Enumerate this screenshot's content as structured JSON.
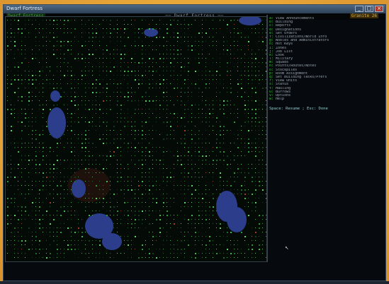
{
  "window": {
    "title": "Dwarf Fortress",
    "buttons": [
      "_",
      "□",
      "×"
    ]
  },
  "game_header": {
    "mode": "Dwarf Fortress",
    "center": "── Dwarf Fortress ──",
    "date": "Granite 26"
  },
  "colors": {
    "menu_key": "#34c234",
    "menu_text": "#9aa6b0",
    "water": "#2c3d8c",
    "grass_dark": "#1c6b2a",
    "grass_light": "#5bd266"
  },
  "menu": {
    "items": [
      {
        "key": "a:",
        "label": "View Announcements"
      },
      {
        "key": "b:",
        "label": "Building"
      },
      {
        "key": "c:",
        "label": "Reports"
      },
      {
        "key": "d:",
        "label": "Designations"
      },
      {
        "key": "e:",
        "label": "Set Orders"
      },
      {
        "key": "f:",
        "label": "Civilizations/World Info"
      },
      {
        "key": "g:",
        "label": "Nobles and Administrators"
      },
      {
        "key": "h:",
        "label": "Hot Keys"
      },
      {
        "key": "i:",
        "label": "Zones"
      },
      {
        "key": "j:",
        "label": "Job List"
      },
      {
        "key": "k:",
        "label": "Look"
      },
      {
        "key": "l:",
        "label": "Military"
      },
      {
        "key": "m:",
        "label": "Squads"
      },
      {
        "key": "n:",
        "label": "Points/Routes/Notes"
      },
      {
        "key": "o:",
        "label": "Stockpiles"
      },
      {
        "key": "p:",
        "label": "Room Assignment"
      },
      {
        "key": "q:",
        "label": "Set Building Tasks/Prefs"
      },
      {
        "key": "r:",
        "label": "View Units"
      },
      {
        "key": "s:",
        "label": "Status"
      },
      {
        "key": "t:",
        "label": "Hauling"
      },
      {
        "key": "u:",
        "label": "Burrows"
      },
      {
        "key": "v:",
        "label": "Options"
      },
      {
        "key": "w:",
        "label": "Help"
      }
    ],
    "designate": "Space: Resume  ;  Esc: Done"
  },
  "map_tiles": "terrain-grass-and-shrubs",
  "lakes": "water-pools"
}
